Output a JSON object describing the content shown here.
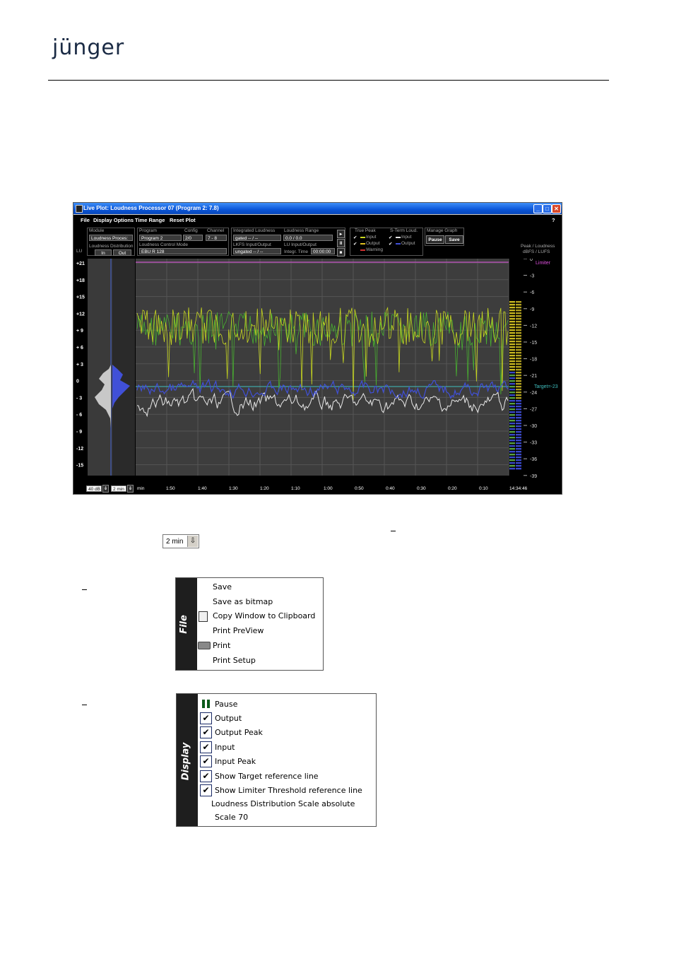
{
  "logo": "jünger",
  "window": {
    "title": "Live Plot:  Loudness Processor 07  (Program 2: 7.8)",
    "help": "?",
    "menu": [
      "File",
      "Display Options",
      "Time Range",
      "Reset Plot"
    ],
    "module": {
      "label": "Module",
      "value": "Loudness Proces:"
    },
    "program": {
      "label": "Program",
      "value": "Program 2"
    },
    "config": {
      "label": "Config",
      "value": "2/0"
    },
    "channel": {
      "label": "Channel",
      "value": "7 - 8"
    },
    "control_mode": {
      "label": "Loudness Control Mode",
      "value": "EBU R 128"
    },
    "integrated": {
      "label": "Integrated Loudness",
      "value": "gated    -- / --"
    },
    "range": {
      "label": "Loudness Range",
      "value": "0.0 / 0.0"
    },
    "lkfs": {
      "label": "LKFS Input/Output",
      "value": "ungated   -- / --"
    },
    "lu_io": {
      "label": "LU Input/Output",
      "value": ""
    },
    "integr_time": {
      "label": "Integr. Time",
      "value": "00:00:00"
    },
    "true_peak": {
      "label": "True Peak",
      "input": "Input",
      "output": "Output",
      "warning": "Warning"
    },
    "short_term": {
      "label": "S-Term Loud.",
      "input": "Input",
      "output": "Output"
    },
    "manage": {
      "label": "Manage Graph",
      "pause": "Pause",
      "save": "Save"
    },
    "lu_label": "LU",
    "dist_label": "Loudness Distribution",
    "dist_in": "In",
    "dist_out": "Out",
    "right_header": [
      "Peak / Loudness",
      "dBFS / LUFS"
    ],
    "left_ticks": [
      "+21",
      "+18",
      "+15",
      "+12",
      "+ 9",
      "+ 6",
      "+ 3",
      "0",
      "- 3",
      "- 6",
      "- 9",
      "-12",
      "-15"
    ],
    "right_ticks": [
      "0",
      "-3",
      "-6",
      "-9",
      "-12",
      "-15",
      "-18",
      "-21",
      "-24",
      "-27",
      "-30",
      "-33",
      "-36",
      "-39"
    ],
    "limiter_label": "Limiter",
    "target_label": "Target=-23",
    "scale_select": "40 dB",
    "time_select": "2 min",
    "time_unit": "min",
    "time_ticks": [
      "1:50",
      "1:40",
      "1:30",
      "1:20",
      "1:10",
      "1:00",
      "0:50",
      "0:40",
      "0:30",
      "0:20",
      "0:10"
    ],
    "clock": "14:34:46",
    "colors": {
      "input_peak": "#c8d820",
      "output_peak": "#48b030",
      "input_loud": "#e8e8e8",
      "output_loud": "#4050d8",
      "limiter": "#e050e0",
      "target": "#40c0c0"
    }
  },
  "control_sample": {
    "value": "2 min",
    "arrow": "⇩"
  },
  "file_menu": {
    "title": "File",
    "items": [
      "Save",
      "Save as bitmap",
      "Copy Window to Clipboard",
      "Print PreView",
      "Print",
      "Print Setup"
    ]
  },
  "display_menu": {
    "title": "Display",
    "items": [
      "Pause",
      "Output",
      "Output Peak",
      "Input",
      "Input Peak",
      "Show Target reference line",
      "Show Limiter Threshold reference line",
      "Loudness Distribution Scale absolute",
      "Scale 70"
    ],
    "checked": [
      false,
      true,
      true,
      true,
      true,
      true,
      true,
      false,
      false
    ]
  }
}
